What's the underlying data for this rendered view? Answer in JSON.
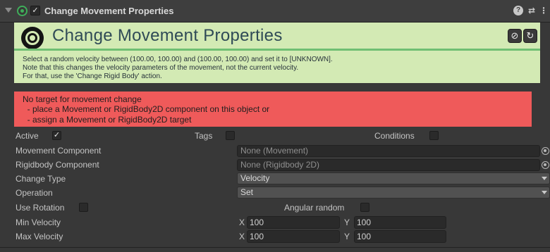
{
  "header": {
    "title": "Change Movement Properties",
    "enabled_checked": true,
    "help_icon": "help-icon",
    "settings_icon": "sliders-icon",
    "more_icon": "more-menu-icon"
  },
  "info": {
    "title": "Change Movement Properties",
    "line1": "Select a random velocity between (100.00, 100.00) and (100.00, 100.00) and set it to [UNKNOWN].",
    "line2": "Note that this changes the velocity parameters of the movement, not the current velocity.",
    "line3": "For that, use the 'Change Rigid Body' action.",
    "background_color": "#d3eab4",
    "accent_color": "#6fbf73"
  },
  "error": {
    "line1": "No target for movement change",
    "line2": "  - place a Movement or RigidBody2D component on this object or",
    "line3": "  - assign a Movement or RigidBody2D target",
    "background_color": "#ef5a5a"
  },
  "fields": {
    "active_label": "Active",
    "active_checked": true,
    "tags_label": "Tags",
    "conditions_label": "Conditions",
    "movement_component_label": "Movement Component",
    "movement_component_value": "None (Movement)",
    "rigidbody_component_label": "Rigidbody Component",
    "rigidbody_component_value": "None (Rigidbody 2D)",
    "change_type_label": "Change Type",
    "change_type_value": "Velocity",
    "operation_label": "Operation",
    "operation_value": "Set",
    "use_rotation_label": "Use Rotation",
    "angular_random_label": "Angular random",
    "min_velocity_label": "Min Velocity",
    "min_velocity_x": "100",
    "min_velocity_y": "100",
    "max_velocity_label": "Max Velocity",
    "max_velocity_x": "100",
    "max_velocity_y": "100",
    "x_axis_label": "X",
    "y_axis_label": "Y"
  }
}
